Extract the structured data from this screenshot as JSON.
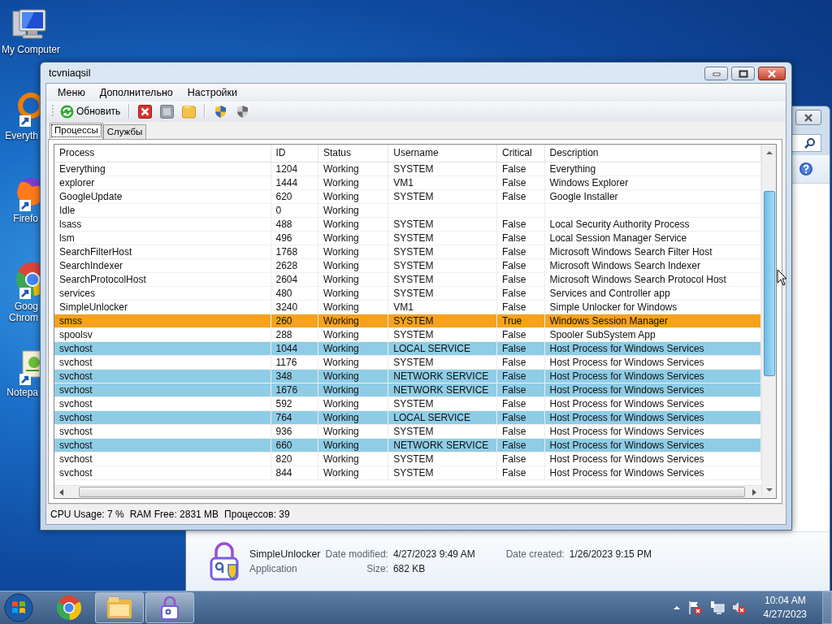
{
  "desktop_icons": [
    {
      "kind": "computer",
      "lines": [
        "My Computer"
      ]
    },
    {
      "kind": "ring",
      "lines": [
        "Everyth"
      ]
    },
    {
      "kind": "fox",
      "lines": [
        "Firefo"
      ]
    },
    {
      "kind": "chrome",
      "lines": [
        "Goog",
        "Chrom"
      ]
    },
    {
      "kind": "notepad",
      "lines": [
        "Notepa"
      ]
    }
  ],
  "explorer_window": {
    "details": {
      "name": "SimpleUnlocker",
      "type": "Application",
      "modified_label": "Date modified:",
      "modified": "4/27/2023 9:49 AM",
      "size_label": "Size:",
      "size": "682 KB",
      "created_label": "Date created:",
      "created": "1/26/2023 9:15 PM"
    }
  },
  "window": {
    "title": "tcvniaqsil",
    "menu": [
      "Меню",
      "Дополнительно",
      "Настройки"
    ],
    "toolbar": [
      [
        {
          "kind": "refresh",
          "label": "Обновить"
        }
      ],
      [
        {
          "kind": "delete"
        },
        {
          "kind": "stop"
        },
        {
          "kind": "folder"
        }
      ],
      [
        {
          "kind": "shield"
        },
        {
          "kind": "shield-gray"
        }
      ]
    ],
    "tabs": [
      {
        "label": "Процессы",
        "selected": true
      },
      {
        "label": "Службы",
        "selected": false
      }
    ],
    "table": {
      "columns": [
        "Process",
        "ID",
        "Status",
        "Username",
        "Critical",
        "Description"
      ],
      "rows": [
        {
          "process": "Everything",
          "id": "1204",
          "status": "Working",
          "username": "SYSTEM",
          "critical": "False",
          "description": "Everything"
        },
        {
          "process": "explorer",
          "id": "1444",
          "status": "Working",
          "username": "VM1",
          "critical": "False",
          "description": "Windows Explorer"
        },
        {
          "process": "GoogleUpdate",
          "id": "620",
          "status": "Working",
          "username": "SYSTEM",
          "critical": "False",
          "description": "Google Installer"
        },
        {
          "process": "Idle",
          "id": "0",
          "status": "Working"
        },
        {
          "process": "lsass",
          "id": "488",
          "status": "Working",
          "username": "SYSTEM",
          "critical": "False",
          "description": "Local Security Authority Process"
        },
        {
          "process": "lsm",
          "id": "496",
          "status": "Working",
          "username": "SYSTEM",
          "critical": "False",
          "description": "Local Session Manager Service"
        },
        {
          "process": "SearchFilterHost",
          "id": "1768",
          "status": "Working",
          "username": "SYSTEM",
          "critical": "False",
          "description": "Microsoft Windows Search Filter Host"
        },
        {
          "process": "SearchIndexer",
          "id": "2628",
          "status": "Working",
          "username": "SYSTEM",
          "critical": "False",
          "description": "Microsoft Windows Search Indexer"
        },
        {
          "process": "SearchProtocolHost",
          "id": "2604",
          "status": "Working",
          "username": "SYSTEM",
          "critical": "False",
          "description": "Microsoft Windows Search Protocol Host"
        },
        {
          "process": "services",
          "id": "480",
          "status": "Working",
          "username": "SYSTEM",
          "critical": "False",
          "description": "Services and Controller app"
        },
        {
          "process": "SimpleUnlocker",
          "id": "3240",
          "status": "Working",
          "username": "VM1",
          "critical": "False",
          "description": "Simple Unlocker for Windows"
        },
        {
          "process": "smss",
          "id": "260",
          "status": "Working",
          "username": "SYSTEM",
          "critical": "True",
          "description": "Windows Session Manager",
          "color": "#f6a21e"
        },
        {
          "process": "spoolsv",
          "id": "288",
          "status": "Working",
          "username": "SYSTEM",
          "critical": "False",
          "description": "Spooler SubSystem App"
        },
        {
          "process": "svchost",
          "id": "1044",
          "status": "Working",
          "username": "LOCAL SERVICE",
          "critical": "False",
          "description": "Host Process for Windows Services",
          "color": "#8fcde6"
        },
        {
          "process": "svchost",
          "id": "1176",
          "status": "Working",
          "username": "SYSTEM",
          "critical": "False",
          "description": "Host Process for Windows Services"
        },
        {
          "process": "svchost",
          "id": "348",
          "status": "Working",
          "username": "NETWORK SERVICE",
          "critical": "False",
          "description": "Host Process for Windows Services",
          "color": "#8fcde6"
        },
        {
          "process": "svchost",
          "id": "1676",
          "status": "Working",
          "username": "NETWORK SERVICE",
          "critical": "False",
          "description": "Host Process for Windows Services",
          "color": "#8fcde6"
        },
        {
          "process": "svchost",
          "id": "592",
          "status": "Working",
          "username": "SYSTEM",
          "critical": "False",
          "description": "Host Process for Windows Services"
        },
        {
          "process": "svchost",
          "id": "764",
          "status": "Working",
          "username": "LOCAL SERVICE",
          "critical": "False",
          "description": "Host Process for Windows Services",
          "color": "#8fcde6"
        },
        {
          "process": "svchost",
          "id": "936",
          "status": "Working",
          "username": "SYSTEM",
          "critical": "False",
          "description": "Host Process for Windows Services"
        },
        {
          "process": "svchost",
          "id": "660",
          "status": "Working",
          "username": "NETWORK SERVICE",
          "critical": "False",
          "description": "Host Process for Windows Services",
          "color": "#8fcde6"
        },
        {
          "process": "svchost",
          "id": "820",
          "status": "Working",
          "username": "SYSTEM",
          "critical": "False",
          "description": "Host Process for Windows Services"
        },
        {
          "process": "svchost",
          "id": "844",
          "status": "Working",
          "username": "SYSTEM",
          "critical": "False",
          "description": "Host Process for Windows Services"
        }
      ]
    },
    "status_bar": [
      "CPU Usage: 7 %",
      "RAM Free: 2831 MB",
      "Процессов: 39"
    ]
  },
  "taskbar": {
    "buttons": [
      {
        "kind": "start"
      },
      {
        "kind": "chrome"
      },
      {
        "kind": "explorer"
      },
      {
        "kind": "unlocker"
      }
    ],
    "tray": [
      {
        "kind": "arrow"
      },
      {
        "kind": "flag"
      },
      {
        "kind": "network"
      },
      {
        "kind": "volume"
      }
    ],
    "clock": {
      "time": "10:04 AM",
      "date": "4/27/2023"
    }
  }
}
